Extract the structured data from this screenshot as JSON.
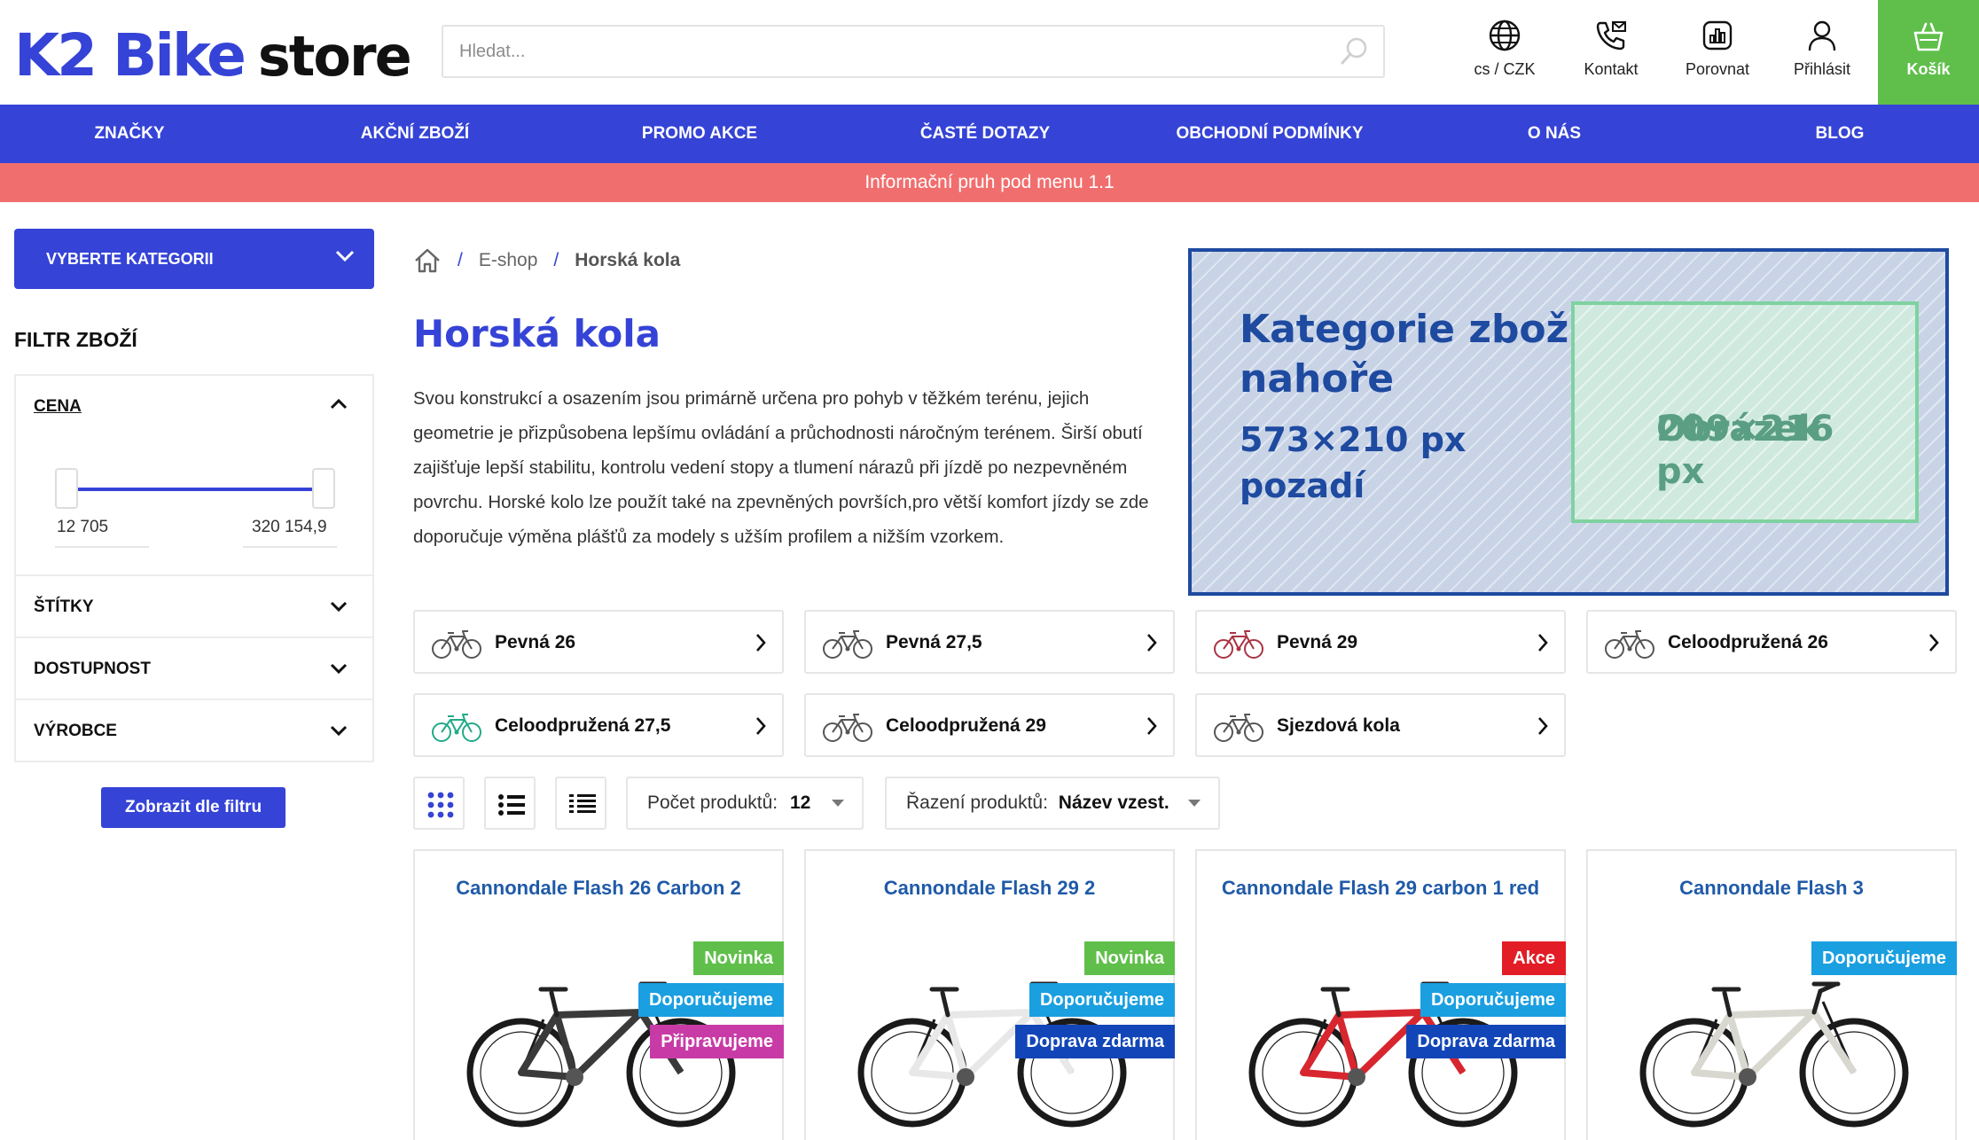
{
  "header": {
    "logo_k2": "K2 Bike",
    "logo_store": "store",
    "search_placeholder": "Hledat...",
    "lang_label": "cs  /  CZK",
    "contact_label": "Kontakt",
    "compare_label": "Porovnat",
    "login_label": "Přihlásit",
    "cart_label": "Košík"
  },
  "nav": {
    "items": [
      "ZNAČKY",
      "AKČNÍ ZBOŽÍ",
      "PROMO AKCE",
      "ČASTÉ DOTAZY",
      "OBCHODNÍ PODMÍNKY",
      "O NÁS",
      "BLOG"
    ]
  },
  "infobar": "Informační pruh pod menu 1.1",
  "sidebar": {
    "category_button": "VYBERTE KATEGORII",
    "filter_title": "FILTR ZBOŽÍ",
    "sections": {
      "price": "CENA",
      "tags": "ŠTÍTKY",
      "availability": "DOSTUPNOST",
      "manufacturer": "VÝROBCE"
    },
    "price_min": "12 705",
    "price_max": "320 154,9",
    "apply_button": "Zobrazit dle filtru"
  },
  "breadcrumb": {
    "eshop": "E-shop",
    "current": "Horská kola"
  },
  "page": {
    "title": "Horská kola",
    "description": "Svou konstrukcí a osazením jsou primárně určena pro pohyb v těžkém terénu, jejich geometrie je přizpůsobena lepšímu ovládání a průchodnosti náročným terénem. Širší obutí zajišťuje lepší stabilitu, kontrolu vedení stopy a tlumení nárazů při jízdě po nezpevněném povrchu. Horské kolo lze použít také na zpevněných površích,pro větší komfort jízdy se zde doporučuje výměna plášťů za modely s užším profilem a nižším vzorkem."
  },
  "banner": {
    "title_line1": "Kategorie zboží",
    "title_line2": "nahoře",
    "size_line1": "573×210 px",
    "size_line2": "pozadí",
    "image_line1": "Obrázek",
    "image_line2": "209×216 px"
  },
  "subcategories": [
    "Pevná 26",
    "Pevná 27,5",
    "Pevná 29",
    "Celoodpružená 26",
    "Celoodpružená 27,5",
    "Celoodpružená 29",
    "Sjezdová kola"
  ],
  "toolbar": {
    "count_label": "Počet produktů:",
    "count_value": "12",
    "sort_label": "Řazení produktů:",
    "sort_value": "Název vzest."
  },
  "products": [
    {
      "name": "Cannondale Flash 26 Carbon 2",
      "tags": [
        "Novinka",
        "Doporučujeme",
        "Připravujeme"
      ],
      "frame_color": "#3a3a3a"
    },
    {
      "name": "Cannondale Flash 29 2",
      "tags": [
        "Novinka",
        "Doporučujeme",
        "Doprava zdarma"
      ],
      "frame_color": "#e8e8e8"
    },
    {
      "name": "Cannondale Flash 29 carbon 1 red",
      "tags": [
        "Akce",
        "Doporučujeme",
        "Doprava zdarma"
      ],
      "frame_color": "#d7262e"
    },
    {
      "name": "Cannondale Flash 3",
      "tags": [
        "Doporučujeme"
      ],
      "frame_color": "#d8d8d0"
    }
  ],
  "colors": {
    "brand_blue": "#3543d6",
    "cart_green": "#5fbf4a",
    "infobar_red": "#f16e6e",
    "link_blue": "#1f5aa8"
  }
}
